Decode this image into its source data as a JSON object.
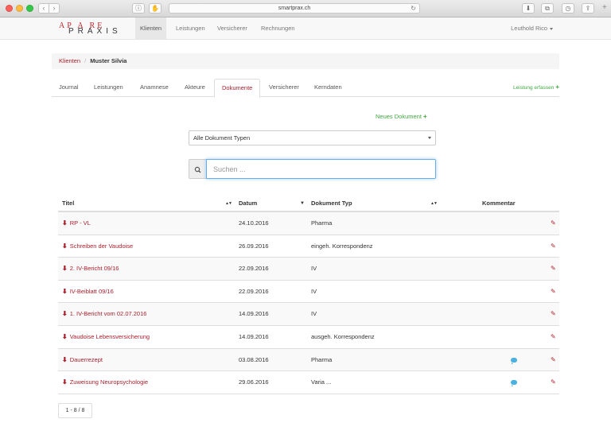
{
  "browser": {
    "url": "smartprax.ch"
  },
  "app": {
    "logo_top": "AP A RE",
    "logo_bottom": "PRAXIS",
    "nav": [
      {
        "label": "Klienten"
      },
      {
        "label": "Leistungen"
      },
      {
        "label": "Versicherer"
      },
      {
        "label": "Rechnungen"
      }
    ],
    "user": "Leuthold Rico"
  },
  "breadcrumb": {
    "parent": "Klienten",
    "separator": "/",
    "current": "Muster Silvia"
  },
  "tabs": [
    {
      "label": "Journal"
    },
    {
      "label": "Leistungen"
    },
    {
      "label": "Anamnese"
    },
    {
      "label": "Akteure"
    },
    {
      "label": "Dokumente"
    },
    {
      "label": "Versicherer"
    },
    {
      "label": "Kerndaten"
    }
  ],
  "active_tab": "Dokumente",
  "tab_action": "Leistung erfassen",
  "new_document": "Neues Dokument",
  "filter": {
    "selected": "Alle Dokument Typen"
  },
  "search": {
    "placeholder": "Suchen ..."
  },
  "table": {
    "columns": {
      "title": "Titel",
      "date": "Datum",
      "type": "Dokument Typ",
      "comment": "Kommentar"
    },
    "rows": [
      {
        "title": "RP - VL",
        "date": "24.10.2016",
        "type": "Pharma",
        "comment": false
      },
      {
        "title": "Schreiben der Vaudoise",
        "date": "26.09.2016",
        "type": "eingeh. Korrespondenz",
        "comment": false
      },
      {
        "title": "2. IV-Bericht 09/16",
        "date": "22.09.2016",
        "type": "IV",
        "comment": false
      },
      {
        "title": "IV-Beiblatt 09/16",
        "date": "22.09.2016",
        "type": "IV",
        "comment": false
      },
      {
        "title": "1. IV-Bericht vom 02.07.2016",
        "date": "14.09.2016",
        "type": "IV",
        "comment": false
      },
      {
        "title": "Vaudoise Lebensversicherung",
        "date": "14.09.2016",
        "type": "ausgeh. Korrespondenz",
        "comment": false
      },
      {
        "title": "Dauerrezept",
        "date": "03.08.2016",
        "type": "Pharma",
        "comment": true
      },
      {
        "title": "Zuweisung Neuropsychologie",
        "date": "29.06.2016",
        "type": "Varia ...",
        "comment": true
      }
    ]
  },
  "pager": "1 - 8 / 8",
  "colors": {
    "accent": "#a91e2a",
    "green": "#3fa83f",
    "comment": "#4ab0e0"
  }
}
